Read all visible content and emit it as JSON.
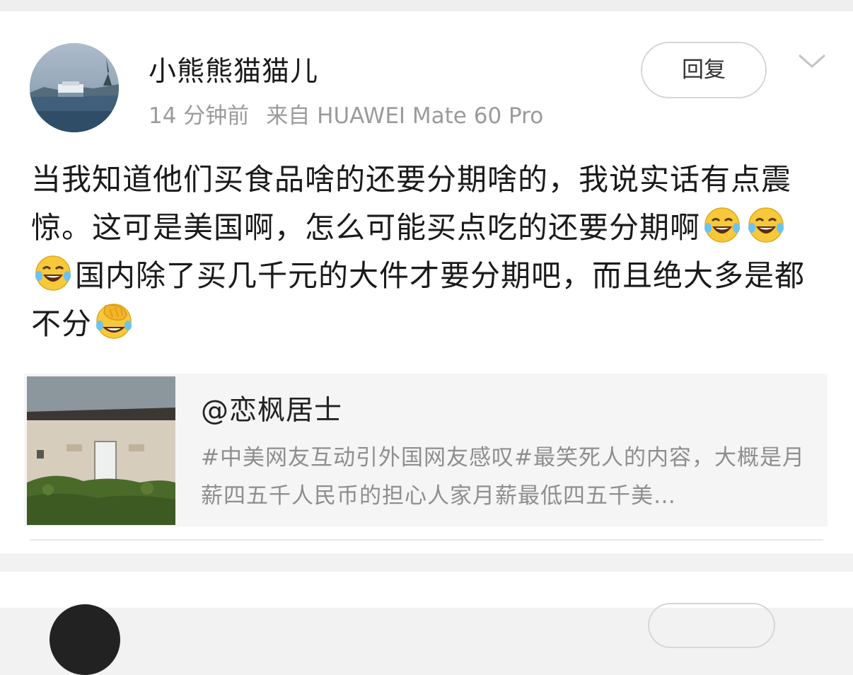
{
  "post": {
    "author": "小熊熊猫猫儿",
    "time": "14 分钟前",
    "source": "来自 HUAWEI Mate 60 Pro",
    "reply_label": "回复",
    "text_part1": "当我知道他们买食品啥的还要分期啥的，我说实话有点震惊。这可是美国啊，怎么可能买点吃的还要分期啊",
    "text_part2": "国内除了买几千元的大件才要分期吧，而且绝大多是都不分",
    "emojis": [
      "laugh-cry-emoji",
      "laugh-cry-emoji",
      "laugh-cry-emoji",
      "facepalm-cry-emoji"
    ]
  },
  "quoted": {
    "author": "@恋枫居士",
    "text": "#中美网友互动引外国网友感叹#最笑死人的内容，大概是月薪四五千人民币的担心人家月薪最低四五千美…"
  },
  "colors": {
    "background": "#f2f2f2",
    "card": "#ffffff",
    "meta_text": "#9b9b9b",
    "quote_bg": "#f5f5f5",
    "emoji_yellow": "#f7c83a"
  }
}
